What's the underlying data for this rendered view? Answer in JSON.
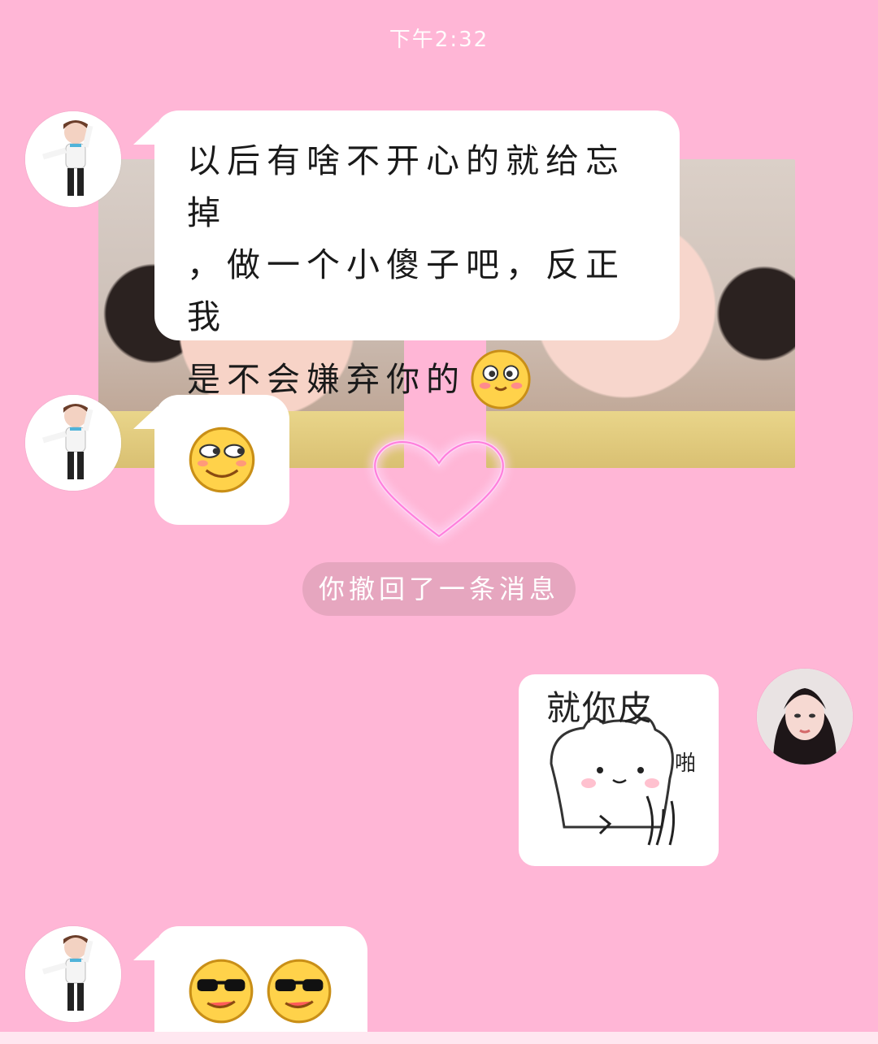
{
  "status": {
    "time": "下午2:32"
  },
  "messages": [
    {
      "sender": "contact",
      "text_line1": "以后有啥不开心的就给忘掉",
      "text_line2": "，做一个小傻子吧，反正我",
      "text_line3": "是不会嫌弃你的",
      "emoji": "blush-emoji"
    },
    {
      "sender": "contact",
      "emoji": "smirk-emoji"
    },
    {
      "sender": "self",
      "sticker_caption": "就你皮",
      "sticker_side_text": "啪"
    },
    {
      "sender": "contact",
      "emojis": [
        "cool-emoji",
        "cool-emoji"
      ]
    }
  ],
  "system_notice": "你撤回了一条消息",
  "colors": {
    "background": "#ffb6d6",
    "bubble": "#ffffff",
    "notice_pill": "#e6a6bf",
    "heart_glow": "#ff6fd8"
  },
  "icons": [
    "contact-avatar",
    "self-avatar",
    "heart-glow-decoration"
  ]
}
